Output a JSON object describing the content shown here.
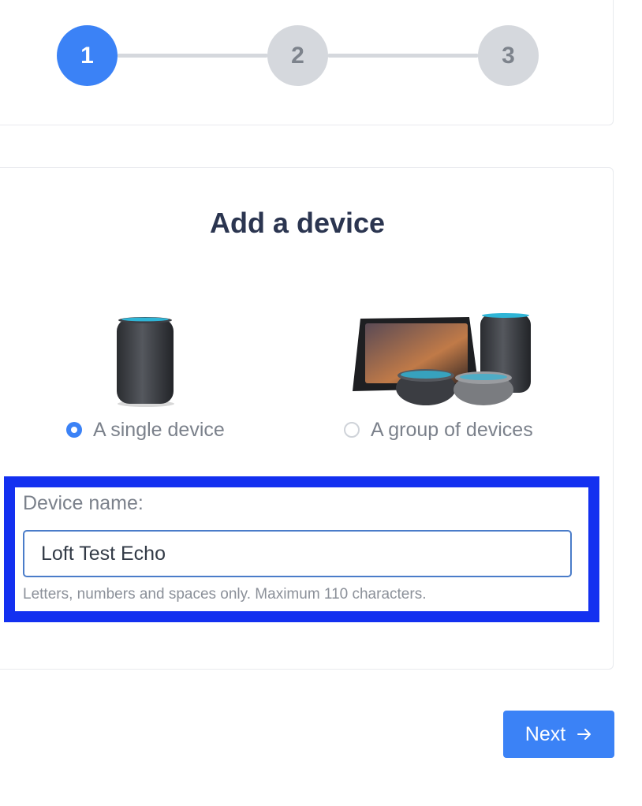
{
  "stepper": {
    "steps": [
      {
        "label": "1",
        "state": "active"
      },
      {
        "label": "2",
        "state": "inactive"
      },
      {
        "label": "3",
        "state": "inactive"
      }
    ]
  },
  "page_title": "Add a device",
  "options": {
    "single": {
      "label": "A single device",
      "selected": true,
      "image_icon": "smart-speaker-icon"
    },
    "group": {
      "label": "A group of devices",
      "selected": false,
      "image_icon": "device-group-icon"
    }
  },
  "form": {
    "name_label": "Device name:",
    "name_value": "Loft Test Echo",
    "helper_text": "Letters, numbers and spaces only. Maximum 110 characters."
  },
  "actions": {
    "next_label": "Next",
    "next_icon": "arrow-right-icon"
  },
  "colors": {
    "accent": "#3b82f6",
    "highlight": "#1330f0",
    "title": "#2b3550",
    "inactive_step": "#d5d8dd"
  }
}
